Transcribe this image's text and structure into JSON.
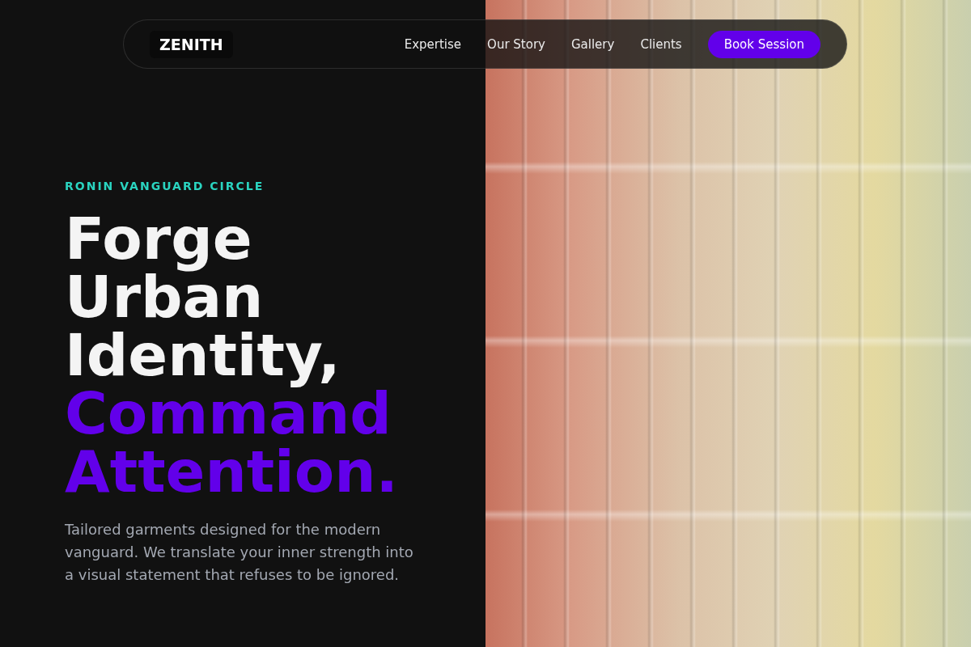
{
  "nav": {
    "logo": "ZENITH",
    "links": [
      "Expertise",
      "Our Story",
      "Gallery",
      "Clients"
    ],
    "cta": "Book Session"
  },
  "hero": {
    "eyebrow": "RONIN VANGUARD CIRCLE",
    "title": "Forge Urban Identity,",
    "title_accent": "Command Attention.",
    "description": "Tailored garments designed for the modern vanguard. We translate your inner strength into a visual statement that refuses to be ignored."
  }
}
